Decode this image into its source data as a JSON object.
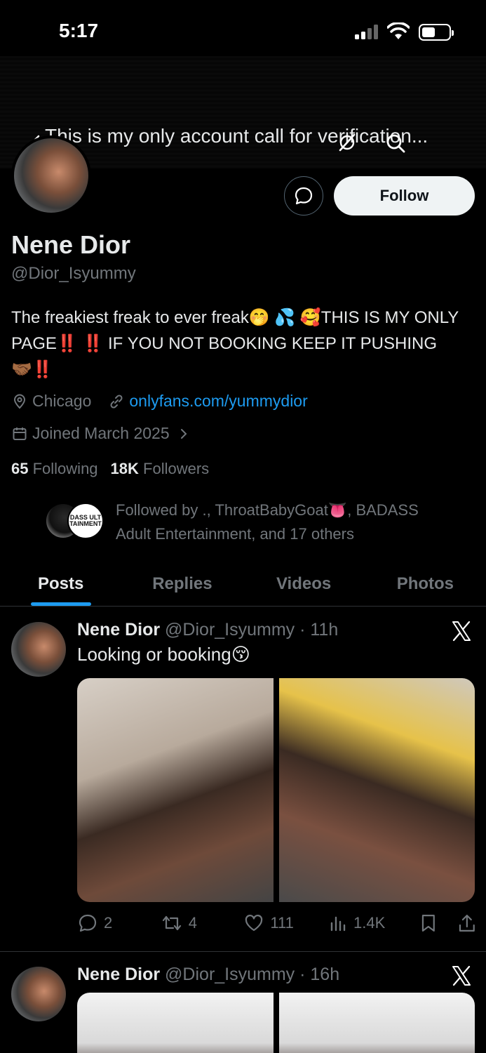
{
  "status_bar": {
    "time": "5:17"
  },
  "header": {
    "banner_title": "This is my only account call for verification..."
  },
  "profile": {
    "display_name": "Nene Dior",
    "handle": "@Dior_Isyummy",
    "bio": "The freakiest freak to ever freak🤭 💦 🥰THIS IS MY ONLY PAGE‼️ ‼️ IF YOU NOT BOOKING KEEP IT PUSHING🤝🏾‼️",
    "location": "Chicago",
    "website": "onlyfans.com/yummydior",
    "joined": "Joined March 2025",
    "following_count": "65",
    "following_label": "Following",
    "followers_count": "18K",
    "followers_label": "Followers",
    "follow_label": "Follow",
    "followed_by_text": "Followed by ., ThroatBabyGoat👅, BADASS Adult Entertainment, and 17 others",
    "followed_by_logo_text": "DASS ULT TAINMENT"
  },
  "tabs": [
    {
      "label": "Posts",
      "active": true
    },
    {
      "label": "Replies",
      "active": false
    },
    {
      "label": "Videos",
      "active": false
    },
    {
      "label": "Photos",
      "active": false
    }
  ],
  "posts": [
    {
      "name": "Nene Dior",
      "meta": "@Dior_Isyummy · 11h",
      "text": "Looking or booking😚",
      "replies": "2",
      "reposts": "4",
      "likes": "111",
      "views": "1.4K"
    },
    {
      "name": "Nene Dior",
      "meta": "@Dior_Isyummy · 16h"
    }
  ],
  "colors": {
    "accent": "#1d9bf0",
    "muted": "#71767b",
    "text": "#e7e9ea",
    "background": "#000000"
  }
}
